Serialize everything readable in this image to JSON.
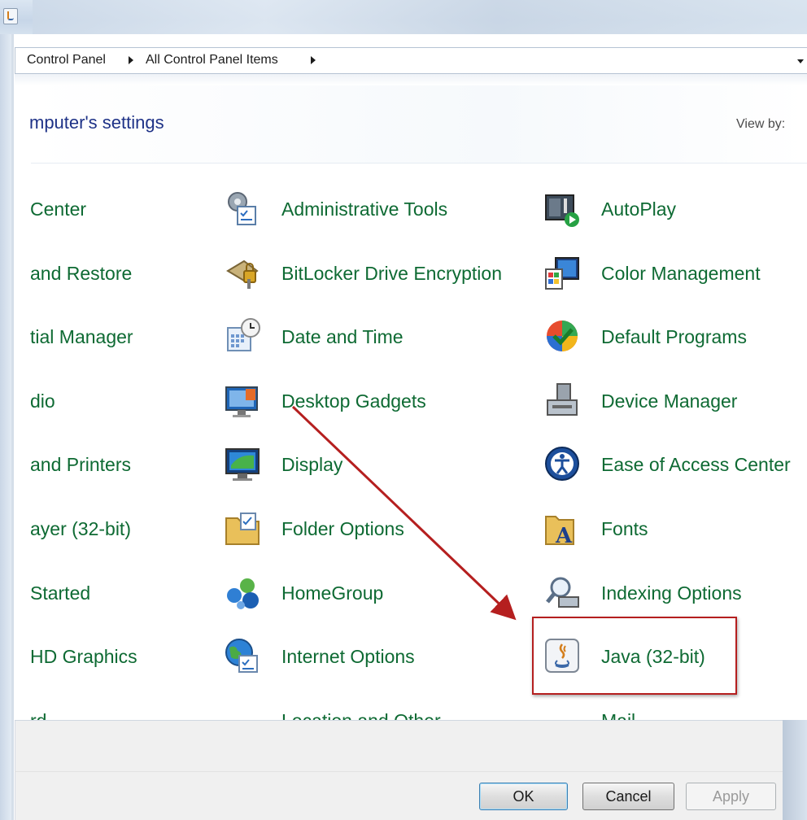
{
  "breadcrumb": {
    "items": [
      "Control Panel",
      "All Control Panel Items"
    ]
  },
  "header": {
    "heading": "mputer's settings",
    "view_by_label": "View by:"
  },
  "items": {
    "col1": [
      "Center",
      "and Restore",
      "tial Manager",
      "dio",
      "and Printers",
      "ayer (32-bit)",
      "Started",
      "HD Graphics",
      "rd"
    ],
    "col2": [
      "Administrative Tools",
      "BitLocker Drive Encryption",
      "Date and Time",
      "Desktop Gadgets",
      "Display",
      "Folder Options",
      "HomeGroup",
      "Internet Options",
      "Location and Other"
    ],
    "col3": [
      "AutoPlay",
      "Color Management",
      "Default Programs",
      "Device Manager",
      "Ease of Access Center",
      "Fonts",
      "Indexing Options",
      "Java (32-bit)",
      "Mail"
    ]
  },
  "dialog_buttons": {
    "ok": "OK",
    "cancel": "Cancel",
    "apply": "Apply"
  },
  "icons": {
    "col2": [
      "admin-tools-icon",
      "bitlocker-icon",
      "date-time-icon",
      "desktop-gadgets-icon",
      "display-icon",
      "folder-options-icon",
      "homegroup-icon",
      "internet-options-icon",
      "location-sensors-icon"
    ],
    "col3": [
      "autoplay-icon",
      "color-management-icon",
      "default-programs-icon",
      "device-manager-icon",
      "ease-of-access-icon",
      "fonts-icon",
      "indexing-options-icon",
      "java-icon",
      "mail-icon"
    ]
  },
  "colors": {
    "link_green": "#0e6a33",
    "heading_blue": "#1e3287",
    "annotation_red": "#b51f1f"
  }
}
